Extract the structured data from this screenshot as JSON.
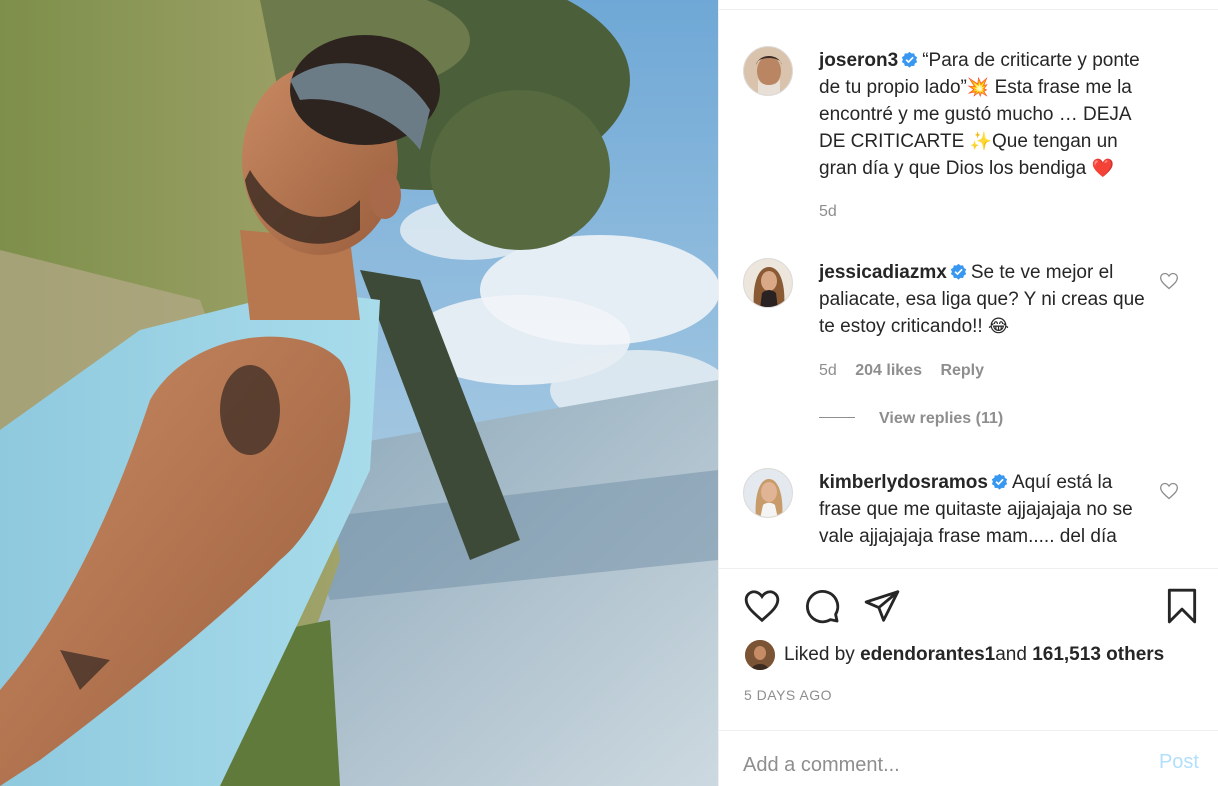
{
  "post": {
    "author": {
      "username": "joseron3",
      "verified": true
    },
    "caption": {
      "text_part1": "“Para de criticarte y ponte de tu propio lado”",
      "emoji1": "💥",
      "text_part2": " Esta frase me la encontré y me gustó mucho … DEJA DE CRITICARTE ",
      "emoji2": "✨",
      "text_part3": "Que tengan un gran día y que Dios los bendiga ",
      "emoji3": "❤️"
    },
    "caption_age": "5d"
  },
  "comments": [
    {
      "username": "jessicadiazmx",
      "verified": true,
      "text": "Se te ve mejor el paliacate, esa liga que? Y ni creas que te estoy criticando!! ",
      "emoji": "😂",
      "age": "5d",
      "likes": "204 likes",
      "reply_label": "Reply",
      "view_replies": "View replies (11)"
    },
    {
      "username": "kimberlydosramos",
      "verified": true,
      "text": "Aquí está la frase que me quitaste ajjajajaja no se vale ajjajajaja frase mam..... del día"
    }
  ],
  "liked_by": {
    "prefix": "Liked by ",
    "user": "edendorantes1",
    "middle": " and ",
    "others": "161,513 others"
  },
  "date_label": "5 DAYS AGO",
  "comment_box": {
    "placeholder": "Add a comment...",
    "post_label": "Post"
  },
  "colors": {
    "verified_blue": "#3897f0",
    "link_blue_disabled": "#b2dffc",
    "secondary_text": "#8e8e8e",
    "heart_red": "#ed4956"
  }
}
